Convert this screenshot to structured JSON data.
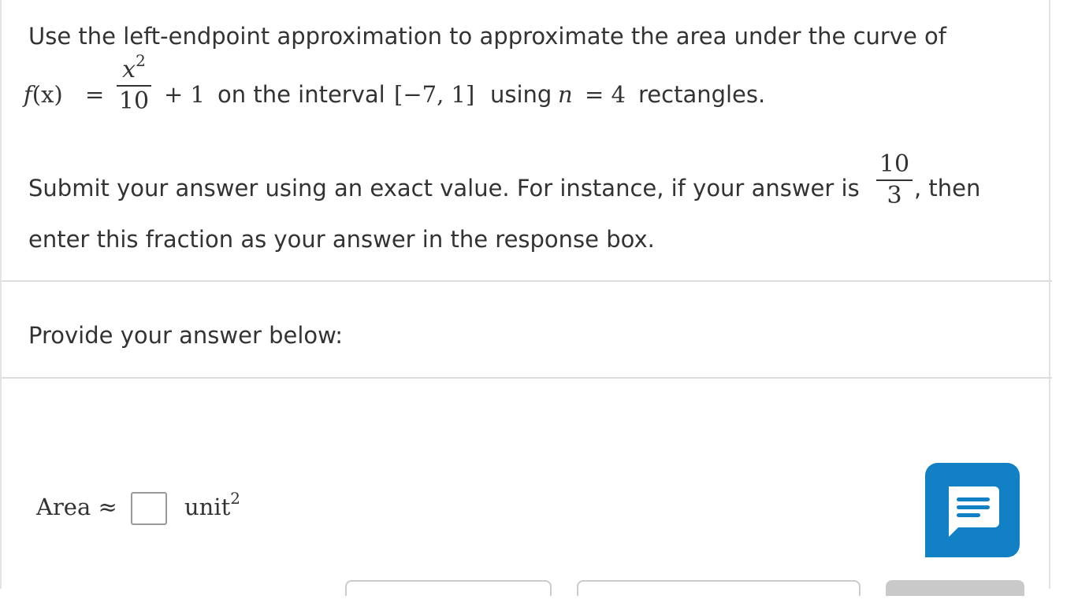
{
  "question": {
    "line1": "Use the left-endpoint approximation to approximate the area under the curve of",
    "fx": "f",
    "x_paren": "(x)",
    "equals": "=",
    "frac_num": "x",
    "frac_num_exp": "2",
    "frac_den": "10",
    "plus_one": "+ 1",
    "on_the_interval": "on the interval",
    "interval": "[−7, 1]",
    "using": "using",
    "n_var": "n",
    "n_eq": "= 4",
    "rectangles": "rectangles.",
    "submit_text": "Submit your answer using an exact value. For instance, if your answer is",
    "example_num": "10",
    "example_den": "3",
    "comma_then": ", then",
    "enter_text": "enter this fraction as your answer in the response box."
  },
  "prompt": {
    "provide": "Provide your answer below:"
  },
  "answer": {
    "area_label": "Area ≈",
    "value": "",
    "unit": "unit",
    "unit_exp": "2"
  },
  "chat": {
    "icon": "chat-bubble-icon",
    "color": "#1280c4"
  }
}
